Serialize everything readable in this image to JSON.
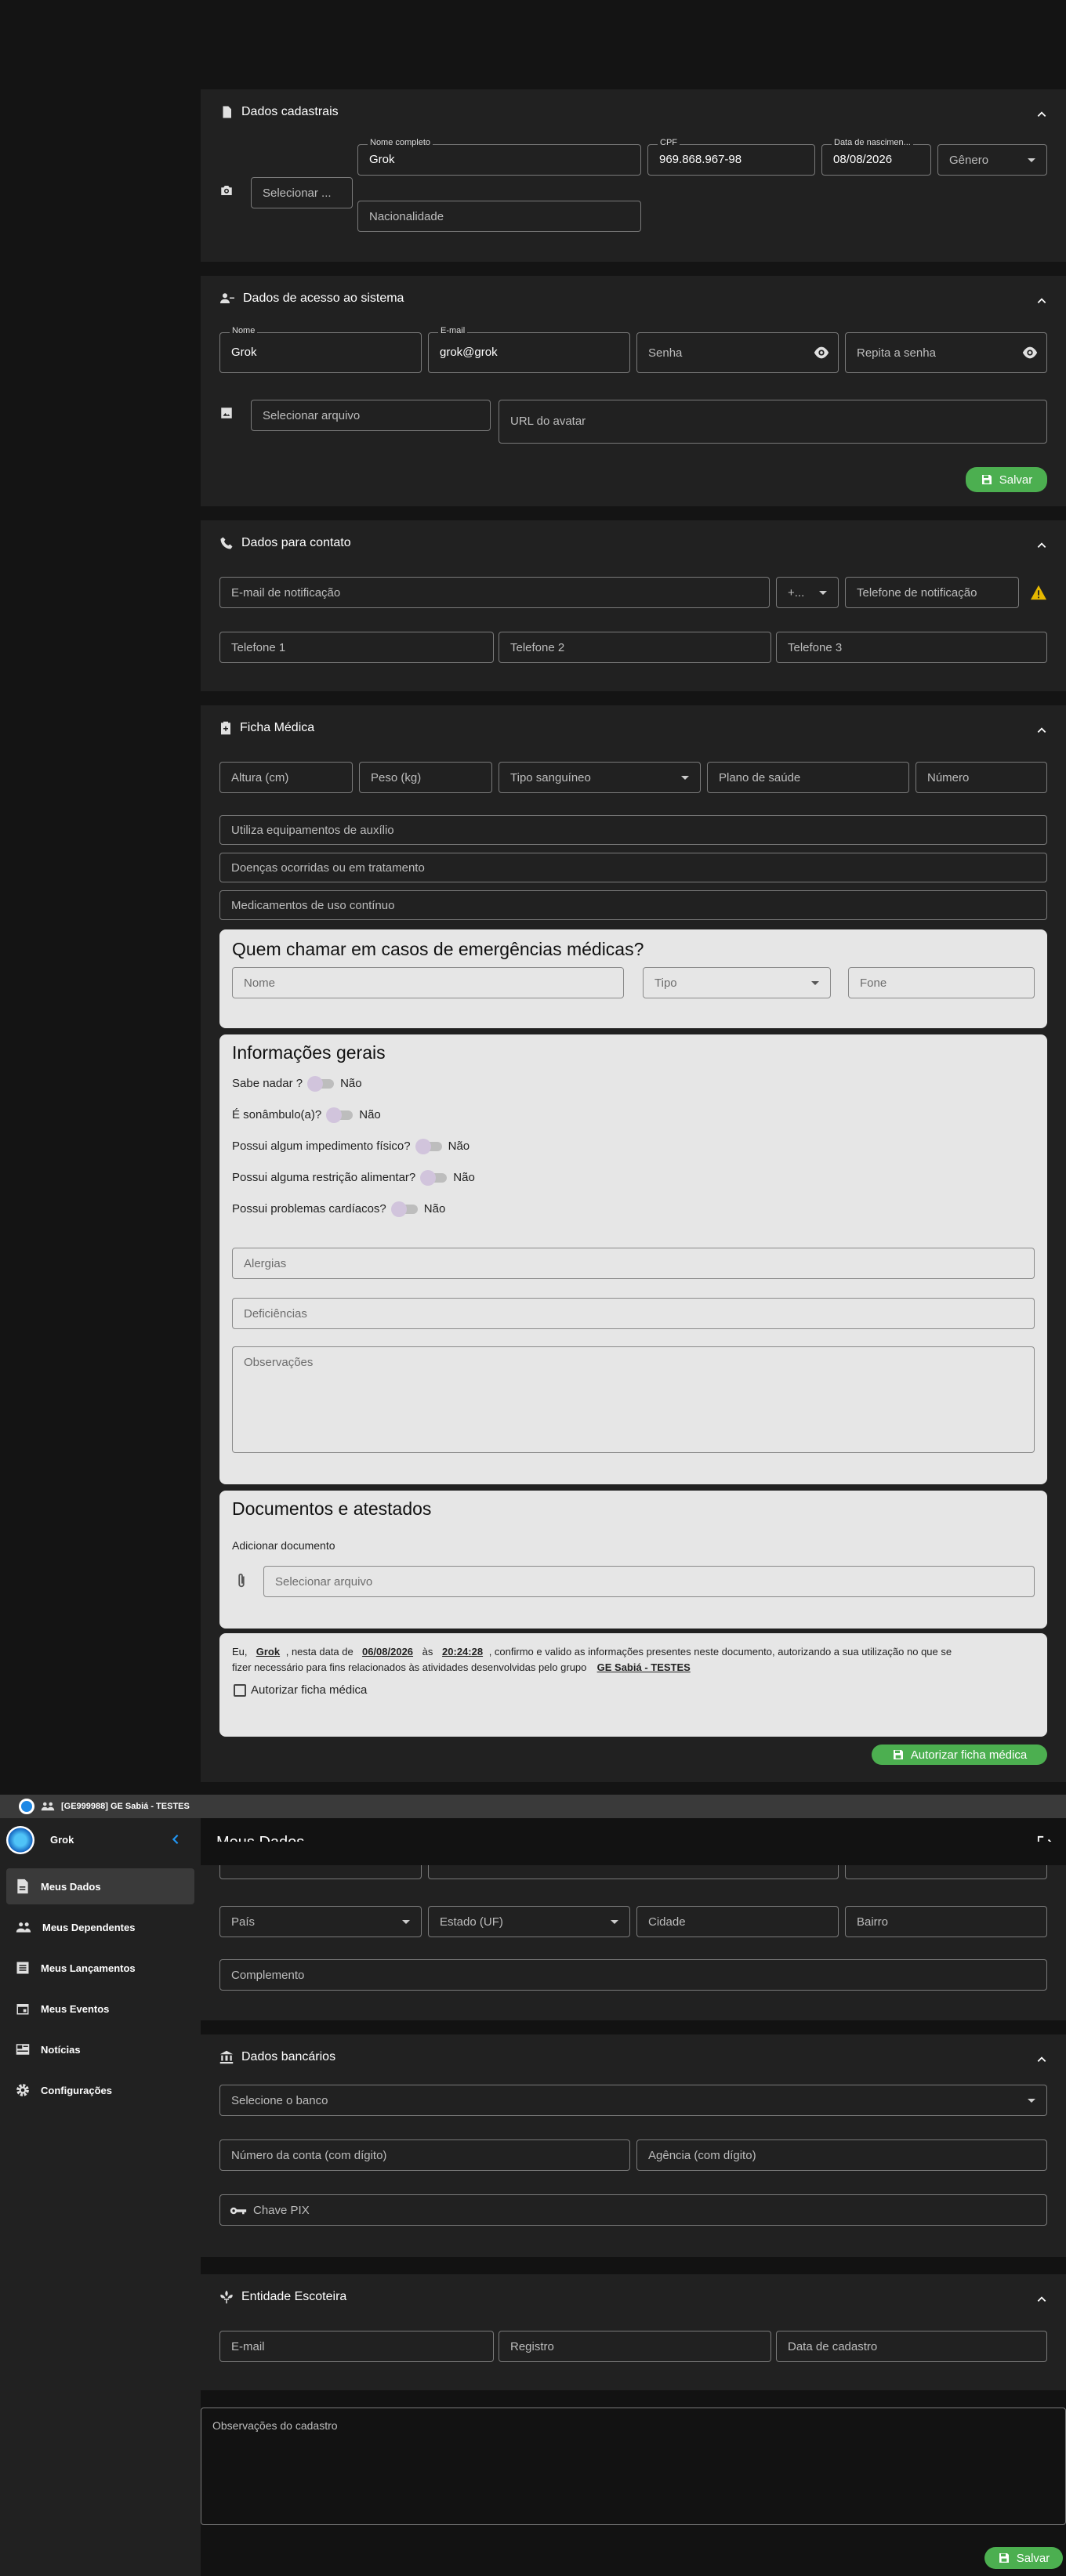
{
  "cadastrais": {
    "title": "Dados cadastrais",
    "select_photo": "Selecionar ...",
    "nome_label": "Nome completo",
    "nome_value": "Grok",
    "cpf_label": "CPF",
    "cpf_value": "969.868.967-98",
    "nasc_label": "Data de nascimen...",
    "nasc_value": "08/08/2026",
    "genero": "Gênero",
    "nacionalidade": "Nacionalidade"
  },
  "acesso": {
    "title": "Dados de acesso ao sistema",
    "nome_label": "Nome",
    "nome_value": "Grok",
    "email_label": "E-mail",
    "email_value": "grok@grok",
    "senha": "Senha",
    "repita": "Repita a senha",
    "select_file": "Selecionar arquivo",
    "avatar_url": "URL do avatar",
    "save": "Salvar"
  },
  "contato": {
    "title": "Dados para contato",
    "email_notif": "E-mail de notificação",
    "ddi": "+...",
    "tel_notif": "Telefone de notificação",
    "tel1": "Telefone 1",
    "tel2": "Telefone 2",
    "tel3": "Telefone 3"
  },
  "ficha": {
    "title": "Ficha Médica",
    "altura": "Altura (cm)",
    "peso": "Peso (kg)",
    "tipo_sangue": "Tipo sanguíneo",
    "plano": "Plano de saúde",
    "numero": "Número",
    "equipamentos": "Utiliza equipamentos de auxílio",
    "doencas": "Doenças ocorridas ou em tratamento",
    "medicamentos": "Medicamentos de uso contínuo",
    "emerg_title": "Quem chamar em casos de emergências médicas?",
    "emerg_nome": "Nome",
    "emerg_tipo": "Tipo",
    "emerg_fone": "Fone",
    "info_title": "Informações gerais",
    "q1": "Sabe nadar ?",
    "q2": "É sonâmbulo(a)?",
    "q3": "Possui algum impedimento físico?",
    "q4": "Possui alguma restrição alimentar?",
    "q5": "Possui problemas cardíacos?",
    "nao": "Não",
    "alergias": "Alergias",
    "deficiencias": "Deficiências",
    "observacoes": "Observações",
    "docs_title": "Documentos e atestados",
    "add_doc": "Adicionar documento",
    "select_file": "Selecionar arquivo",
    "decl_eu": "Eu,",
    "decl_nome": "Grok",
    "decl_data_de": ", nesta data de",
    "decl_data": "06/08/2026",
    "decl_as": "às",
    "decl_hora": "20:24:28",
    "decl_texto1": ", confirmo e valido as informações presentes neste documento, autorizando a sua utilização no que se",
    "decl_texto2": "fizer necessário para fins relacionados às atividades desenvolvidas pelo grupo",
    "decl_grupo": "GE Sabiá - TESTES",
    "autorizar_check": "Autorizar ficha médica",
    "autorizar_btn": "Autorizar ficha médica"
  },
  "taskbar": {
    "title": "[GE999988] GE Sabiá - TESTES"
  },
  "sidebar": {
    "user": "Grok",
    "items": [
      {
        "label": "Meus Dados"
      },
      {
        "label": "Meus Dependentes"
      },
      {
        "label": "Meus Lançamentos"
      },
      {
        "label": "Meus Eventos"
      },
      {
        "label": "Notícias"
      },
      {
        "label": "Configurações"
      }
    ]
  },
  "header": {
    "title": "Meus Dados"
  },
  "endereco": {
    "pais": "País",
    "estado": "Estado (UF)",
    "cidade": "Cidade",
    "bairro": "Bairro",
    "complemento": "Complemento"
  },
  "bancarios": {
    "title": "Dados bancários",
    "banco": "Selecione o banco",
    "conta": "Número da conta (com dígito)",
    "agencia": "Agência (com dígito)",
    "pix": "Chave PIX"
  },
  "entidade": {
    "title": "Entidade Escoteira",
    "email": "E-mail",
    "registro": "Registro",
    "data_cadastro": "Data de cadastro"
  },
  "obs_cadastro": "Observações do cadastro",
  "save_bottom": "Salvar"
}
